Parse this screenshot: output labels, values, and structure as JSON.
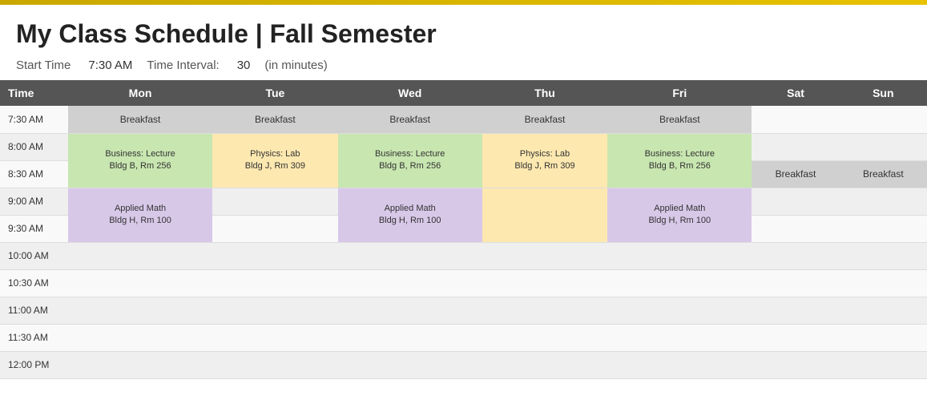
{
  "header": {
    "title": "My Class Schedule | Fall Semester",
    "start_time_label": "Start Time",
    "start_time_value": "7:30 AM",
    "interval_label": "Time Interval:",
    "interval_value": "30",
    "interval_unit": "(in minutes)"
  },
  "table": {
    "columns": [
      "Time",
      "Mon",
      "Tue",
      "Wed",
      "Thu",
      "Fri",
      "Sat",
      "Sun"
    ],
    "time_slots": [
      "7:30 AM",
      "8:00 AM",
      "8:30 AM",
      "9:00 AM",
      "9:30 AM",
      "10:00 AM",
      "10:30 AM",
      "11:00 AM",
      "11:30 AM",
      "12:00 PM"
    ]
  },
  "labels": {
    "breakfast": "Breakfast",
    "business": "Business: Lecture\nBldg B, Rm 256",
    "business_line1": "Business: Lecture",
    "business_line2": "Bldg B, Rm 256",
    "physics": "Physics: Lab\nBldg J, Rm 309",
    "physics_line1": "Physics: Lab",
    "physics_line2": "Bldg J, Rm 309",
    "applied": "Applied Math\nBldg H, Rm 100",
    "applied_line1": "Applied Math",
    "applied_line2": "Bldg H, Rm 100"
  }
}
